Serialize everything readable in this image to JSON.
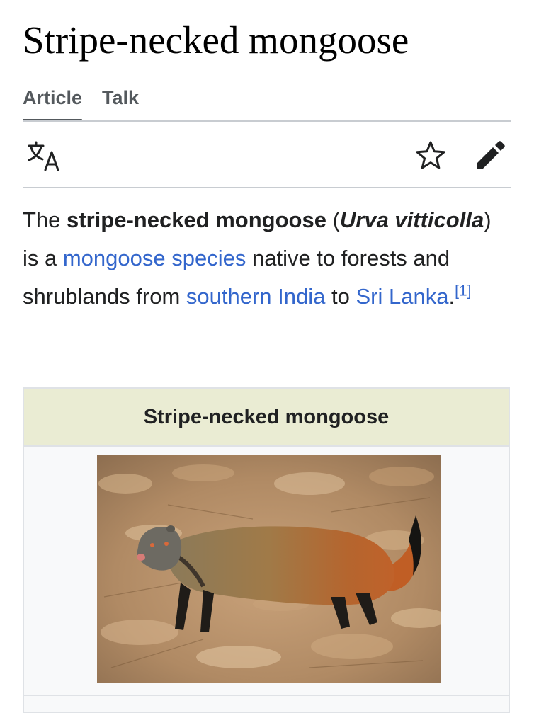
{
  "page": {
    "title": "Stripe-necked mongoose"
  },
  "tabs": [
    {
      "label": "Article",
      "active": true
    },
    {
      "label": "Talk",
      "active": false
    }
  ],
  "toolbar": {
    "icons": [
      "language-icon",
      "star-icon",
      "edit-pencil-icon"
    ]
  },
  "intro": {
    "t1": "The ",
    "common_name": "stripe-necked mongoose",
    "t2": " (",
    "scientific_name": "Urva vitticolla",
    "t3": ") is a ",
    "link_species": "mongoose species",
    "t4": " native to forests and shrublands from ",
    "link_region": "southern India",
    "t5": " to ",
    "link_country": "Sri Lanka",
    "t6": ".",
    "citation": "[1]"
  },
  "infobox": {
    "header": "Stripe-necked mongoose",
    "image_subject": "stripe-necked mongoose on leaf litter"
  },
  "colors": {
    "link": "#3366cc",
    "text": "#202122",
    "tab_text": "#54595d",
    "infobox_header_bg": "#eaecd3",
    "infobox_bg": "#f8f9fa",
    "rule": "#c8ccd1"
  }
}
